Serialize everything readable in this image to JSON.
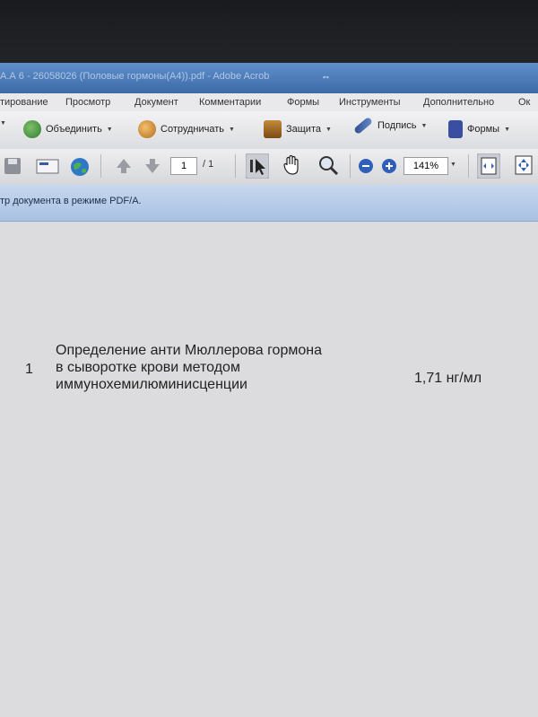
{
  "window": {
    "title": "А.А 6 - 26058026 (Половые гормоны(А4)).pdf - Adobe Acrob",
    "restore_glyph": "⇔"
  },
  "menu": [
    "тирование",
    "Просмотр",
    "Документ",
    "Комментарии",
    "Формы",
    "Инструменты",
    "Дополнительно",
    "Ок"
  ],
  "toolbar": {
    "merge_label": "Объединить",
    "collaborate_label": "Сотрудничать",
    "protect_label": "Защита",
    "sign_label": "Подпись",
    "forms_label": "Формы"
  },
  "navigation": {
    "page_current": "1",
    "page_total": "/ 1",
    "zoom": "141%"
  },
  "infobar": {
    "message": "тр документа в режиме PDF/A."
  },
  "document": {
    "row_number": "1",
    "test_lines": [
      "Определение анти Мюллерова гормона",
      "в сыворотке крови методом",
      "иммунохемилюминисценции"
    ],
    "result": "1,71 нг/мл"
  }
}
